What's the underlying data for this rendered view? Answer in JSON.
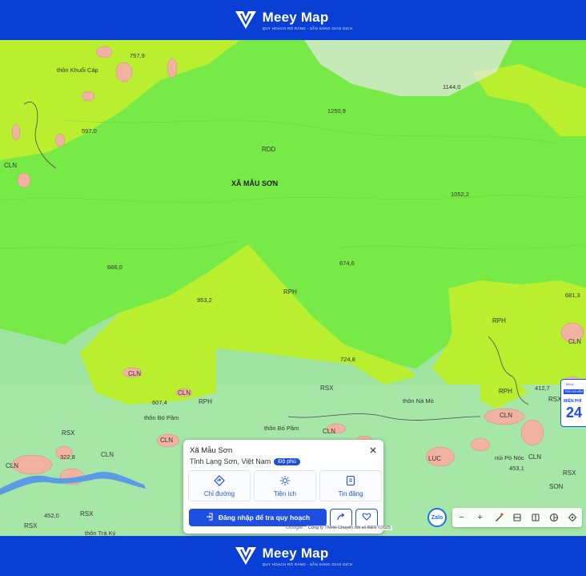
{
  "brand": {
    "name": "Meey Map",
    "tagline": "QUY HOẠCH RÕ RÀNG - SẴN SÀNG GIAO DỊCH"
  },
  "colors": {
    "brand_blue": "#0a3fd6",
    "button_blue": "#1f4fe0",
    "forest_green": "#76ec47",
    "yellow_green": "#b8f02e",
    "light_green": "#a6e8a6",
    "settlement_pink": "#f2b2a2"
  },
  "map": {
    "labels": {
      "village_khuoi_cap": "thôn Khuổi Cáp",
      "commune": "XÃ MẪU SƠN",
      "rdd": "RDD",
      "rph1": "RPH",
      "rph2": "RPH",
      "rph3": "RPH",
      "rph4": "RPH",
      "rsx1": "RSX",
      "rsx2": "RSX",
      "rsx3": "RSX",
      "rsx4": "RSX",
      "rsx5": "RSX",
      "rsx6": "RSX",
      "cln1": "CLN",
      "cln2": "CLN",
      "cln3": "CLN",
      "cln4": "CLN",
      "cln5": "CLN",
      "cln6": "CLN",
      "cln7": "CLN",
      "cln8": "CLN",
      "cln9": "CLN",
      "cln10": "CLN",
      "son": "SON",
      "luc": "LUC",
      "elev_757": "757,9",
      "elev_1144": "1144,0",
      "elev_1250": "1250,9",
      "elev_597": "597,0",
      "elev_1052": "1052,2",
      "elev_686": "686,0",
      "elev_674": "674,6",
      "elev_953": "953,2",
      "elev_681": "681,3",
      "elev_724": "724,8",
      "elev_412": "412,7",
      "elev_453": "453,1",
      "elev_607": "607,4",
      "elev_452": "452,0",
      "elev_322": "322,8",
      "village_bo_pam": "thôn Bó Pầm",
      "village_bo_pam2": "thôn Bó Pầm",
      "village_na_mo": "thôn Nà Mò",
      "village_tra_ky": "thôn Trà Ký",
      "hill_po_noc": "núi Pò Nóc"
    }
  },
  "popup": {
    "title": "Xã Mẫu Sơn",
    "address": "Tỉnh Lạng Sơn, Việt Nam",
    "chip": "Độ phủ",
    "actions": [
      "Chỉ đường",
      "Tiện ích",
      "Tin đăng"
    ],
    "login": "Đăng nhập để tra quy hoạch"
  },
  "zalo": "Zalo",
  "toolbar": {
    "zoom_out": "−",
    "zoom_in": "+"
  },
  "attribution": "Công ty TNHH Chuyển đổi số BĐS ©2025",
  "google": "Google",
  "ad": {
    "small": "Meey",
    "mid": "MIỄN PHÍ",
    "big": "24",
    "chip": "TRẢI NGHIỆM"
  }
}
